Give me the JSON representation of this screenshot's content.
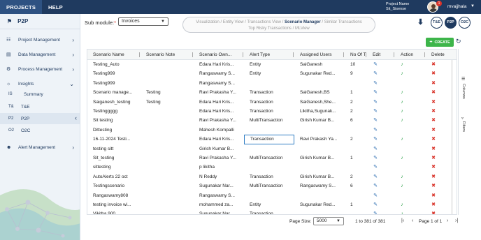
{
  "topbar": {
    "nav": [
      "PROJECTS",
      "HELP"
    ],
    "project_label": "Project Name",
    "project_name": "Sit_Sisense",
    "notifications": "1",
    "user": "mvajjhala"
  },
  "sidebar": {
    "title": "P2P",
    "items": [
      {
        "label": "Project Management",
        "icon": "sitemap-icon"
      },
      {
        "label": "Data Management",
        "icon": "database-icon"
      },
      {
        "label": "Process Management",
        "icon": "cogs-icon"
      },
      {
        "label": "Insights",
        "icon": "lightbulb-icon"
      }
    ],
    "insights_sub": [
      {
        "abbr": "IS",
        "label": "Summary"
      },
      {
        "abbr": "T&",
        "label": "T&E"
      },
      {
        "abbr": "P2",
        "label": "P2P"
      },
      {
        "abbr": "O2",
        "label": "O2C"
      }
    ],
    "alert_management": "Alert Management"
  },
  "toolbar": {
    "sub_module_label": "Sub module:",
    "required_mark": "*",
    "sub_module_value": "Invoices",
    "crumbs_line1": [
      "Visualization",
      "Entity View",
      "Transactions View",
      "Scenario Manager",
      "Similar Transactions"
    ],
    "crumbs_line2": [
      "Top Risky Transactions",
      "MLView"
    ],
    "current_crumb": "Scenario Manager",
    "btn_te": "T&E",
    "btn_p2p": "P2P",
    "btn_o2c": "O2C",
    "create": "CREATE"
  },
  "grid": {
    "columns": [
      "Scenario Name",
      "Scenario Note",
      "Scenario Own...",
      "Alert Type",
      "Assigned Users",
      "No Of T",
      "Edit",
      "Action",
      "Delete"
    ],
    "rows": [
      [
        "Testing_Auto",
        "",
        "Edara Hari Kris...",
        "Entity",
        "SaiGanesh",
        "10",
        true
      ],
      [
        "Testing999",
        "",
        "Rangaswamy S...",
        "Entity",
        "Sugunakar Red...",
        "9",
        true
      ],
      [
        "Testing999",
        "",
        "Rangaswamy S...",
        "",
        "",
        "",
        false
      ],
      [
        "Scenario manage...",
        "Testing",
        "Ravi Prakasha Y...",
        "Transaction",
        "SaiGanesh,BS",
        "1",
        true
      ],
      [
        "Saiganesh_testing",
        "Testing",
        "Edara Hari Kris...",
        "Transaction",
        "SaiGanesh,She...",
        "2",
        true
      ],
      [
        "Testinggggg",
        "",
        "Edara Hari Kris...",
        "Transaction",
        "Likitha,Sugunak...",
        "2",
        true
      ],
      [
        "Sit testing",
        "",
        "Ravi Prakasha Y...",
        "MultiTransaction",
        "Girish Kumar B...",
        "6",
        true
      ],
      [
        "Dittesting",
        "",
        "Mahesh Kompalli",
        "",
        "",
        "",
        false
      ],
      [
        "16-11-2024 Testi...",
        "",
        "Edara Hari Kris...",
        "Transaction",
        "Ravi Prakash Ya...",
        "2",
        true
      ],
      [
        "testing sitt",
        "",
        "Girish Kumar B...",
        "",
        "",
        "",
        false
      ],
      [
        "Sit_testing",
        "",
        "Ravi Prakasha Y...",
        "MultiTransaction",
        "Girish Kumar B...",
        "1",
        true
      ],
      [
        "sittesting",
        "",
        "p likitha",
        "",
        "",
        "",
        false
      ],
      [
        "AutoAlerts 22 oct",
        "",
        "N Reddy",
        "Transaction",
        "Girish Kumar B...",
        "2",
        true
      ],
      [
        "Testingscenario",
        "",
        "Sugunakar Nar...",
        "MultiTransaction",
        "Rangaswamy S...",
        "6",
        true
      ],
      [
        "Rangaswamy808",
        "",
        "Rangaswamy S...",
        "",
        "",
        "",
        false
      ],
      [
        "testing invoice wi...",
        "",
        "mohammed za...",
        "Entity",
        "Sugunakar Red...",
        "1",
        true
      ],
      [
        "Vikitha 900",
        "",
        "Sugunakar Nar...",
        "Transaction",
        "",
        "",
        true
      ]
    ],
    "side_columns": "Columns",
    "side_filters": "Filters"
  },
  "pager": {
    "page_size_label": "Page Size:",
    "page_size": "5000",
    "range": "1 to 381 of 381",
    "page_text": "Page 1 of 1"
  }
}
